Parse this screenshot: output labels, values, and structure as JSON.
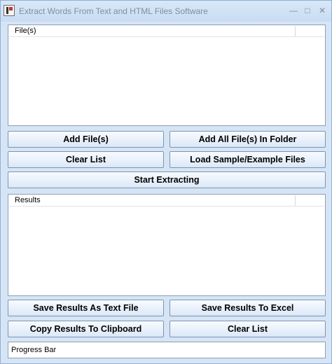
{
  "window": {
    "title": "Extract Words From Text and HTML Files Software",
    "minimize_glyph": "—",
    "maximize_glyph": "□",
    "close_glyph": "✕"
  },
  "files_pane": {
    "header": "File(s)",
    "items": []
  },
  "buttons": {
    "add_files": "Add File(s)",
    "add_all_files_in_folder": "Add All File(s) In Folder",
    "clear_list_top": "Clear List",
    "load_sample": "Load Sample/Example Files",
    "start_extracting": "Start Extracting",
    "save_text_file": "Save Results As Text File",
    "save_excel": "Save Results To Excel",
    "copy_clipboard": "Copy Results To Clipboard",
    "clear_list_bottom": "Clear List"
  },
  "results_pane": {
    "header": "Results",
    "items": []
  },
  "progress": {
    "label": "Progress Bar"
  },
  "icons": {
    "app": "app-icon",
    "minimize": "minimize-icon",
    "maximize": "maximize-icon",
    "close": "close-icon"
  }
}
